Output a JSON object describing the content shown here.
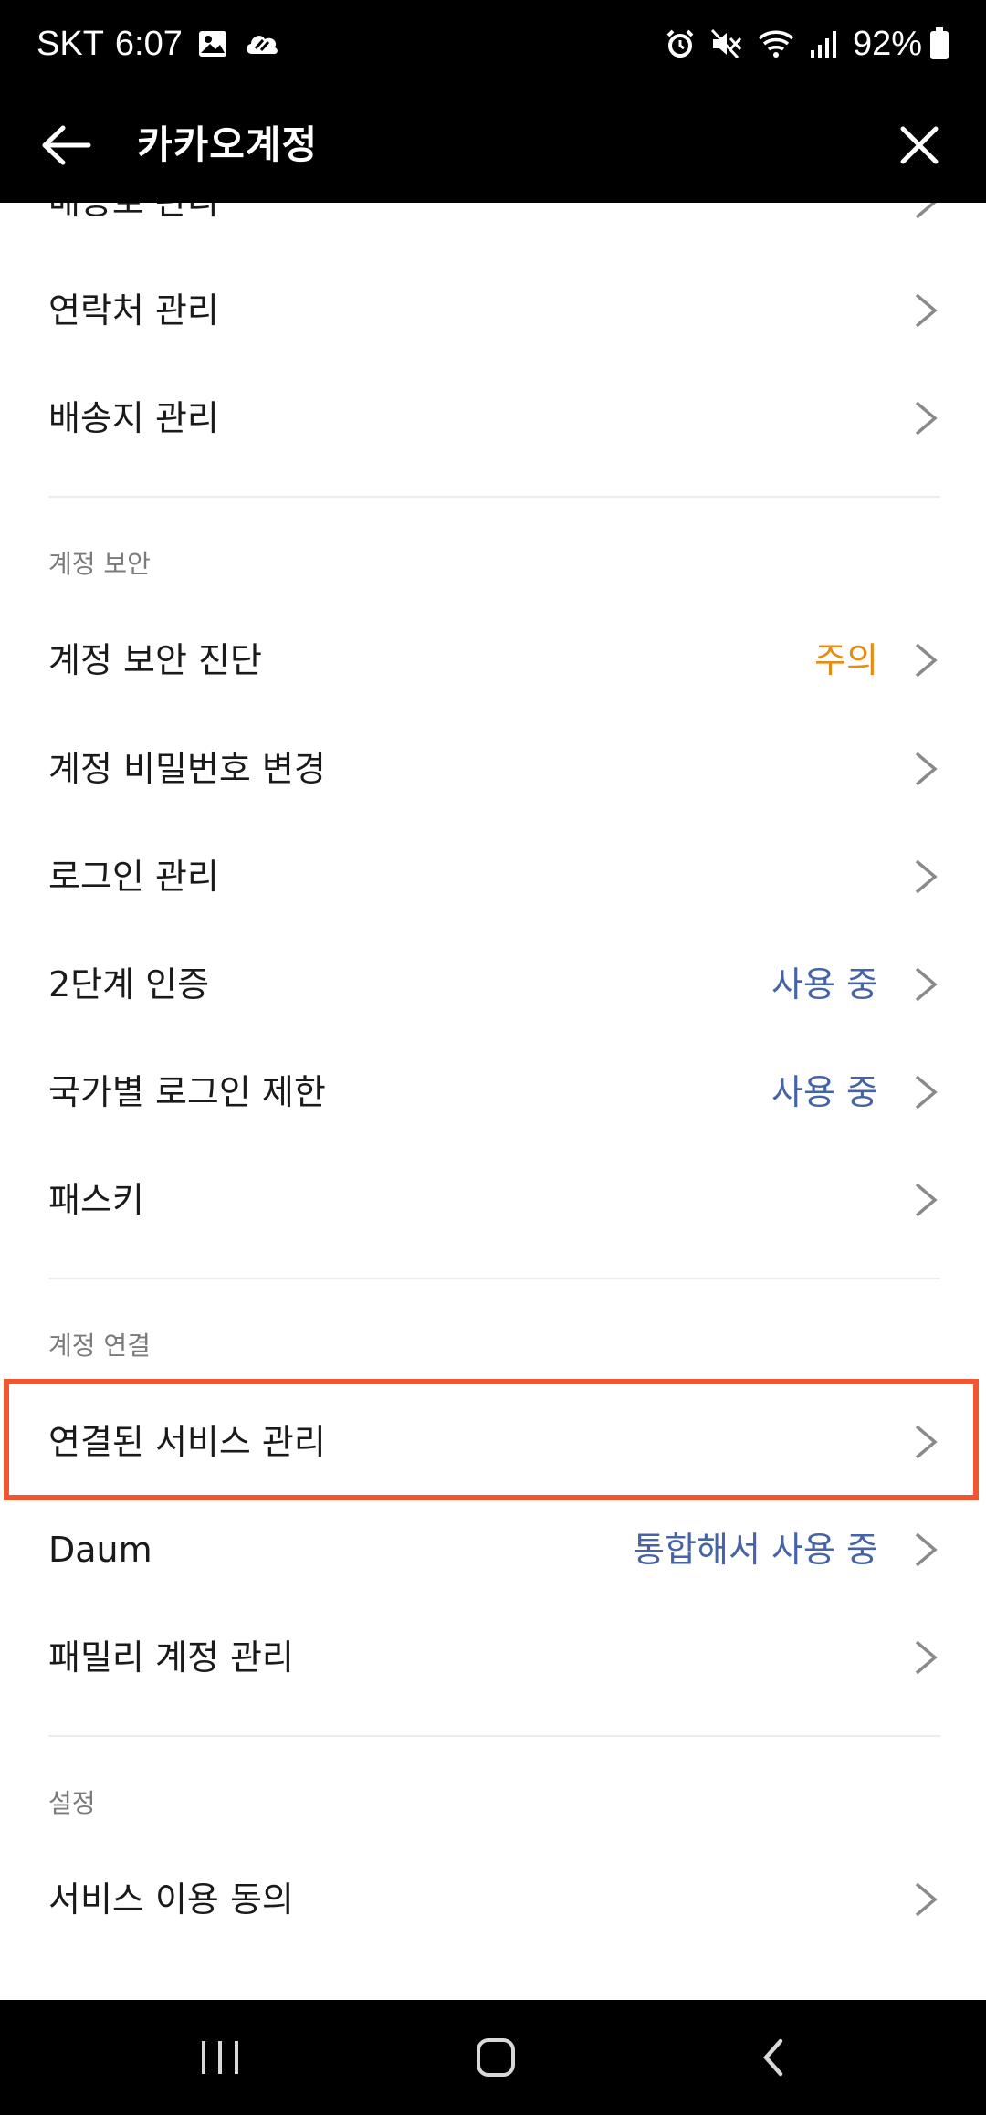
{
  "status_bar": {
    "carrier": "SKT",
    "time": "6:07",
    "battery": "92%",
    "icons_left": [
      "gallery-icon",
      "cloud-icon"
    ],
    "icons_right": [
      "alarm-icon",
      "mute-icon",
      "wifi-icon",
      "signal-icon",
      "battery-icon"
    ]
  },
  "header": {
    "title": "카카오계정",
    "back_icon": "arrow-left-icon",
    "close_icon": "close-icon"
  },
  "list": {
    "partial_top_label": "배송로 관리",
    "items_top": [
      {
        "label": "연락처 관리"
      },
      {
        "label": "배송지 관리"
      }
    ],
    "sections": [
      {
        "title": "계정 보안",
        "items": [
          {
            "label": "계정 보안 진단",
            "value": "주의",
            "value_color": "#e78c12"
          },
          {
            "label": "계정 비밀번호 변경"
          },
          {
            "label": "로그인 관리"
          },
          {
            "label": "2단계 인증",
            "value": "사용 중",
            "value_color": "#4763a8"
          },
          {
            "label": "국가별 로그인 제한",
            "value": "사용 중",
            "value_color": "#4763a8"
          },
          {
            "label": "패스키"
          }
        ]
      },
      {
        "title": "계정 연결",
        "items": [
          {
            "label": "연결된 서비스 관리"
          },
          {
            "label": "Daum",
            "value": "통합해서 사용 중",
            "value_color": "#4763a8"
          },
          {
            "label": "패밀리 계정 관리"
          }
        ]
      },
      {
        "title": "설정",
        "items": [
          {
            "label": "서비스 이용 동의"
          }
        ]
      }
    ]
  },
  "highlight_color": "#f2562f",
  "nav_bar": {
    "buttons": [
      "recent-apps-icon",
      "home-icon",
      "back-icon"
    ]
  }
}
